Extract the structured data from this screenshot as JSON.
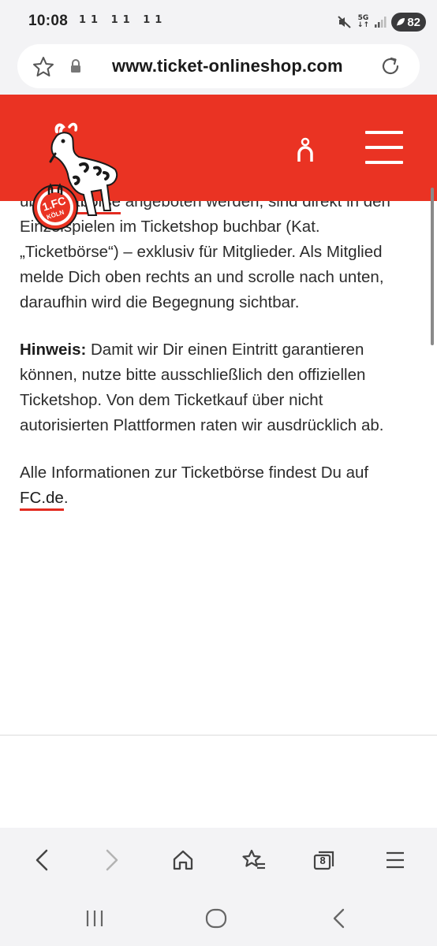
{
  "status": {
    "time": "10:08",
    "notifications": "11 11 11",
    "network": "5G",
    "battery": "82"
  },
  "browser": {
    "url": "www.ticket-onlineshop.com",
    "tab_count": "8"
  },
  "header": {
    "logo_text_top": "1.FC",
    "logo_text_bottom": "KÖLN"
  },
  "content": {
    "p1_cut_pre": "üb",
    "p1_cut_link": "Ticketbörse",
    "p1_cut_post": " angeboten werden, sind",
    "p1_rest": "direkt in den Einzelspielen im Ticketshop buchbar (Kat. „Ticketbörse“) – exklusiv für Mitglieder. Als Mitglied melde Dich oben rechts an und scrolle nach unten, daraufhin wird die Begegnung sichtbar.",
    "p2_label": "Hinweis:",
    "p2_text": " Damit wir Dir einen Eintritt garantieren können, nutze bitte ausschließlich den offiziellen Ticketshop. Von dem Ticketkauf über nicht autorisierten Plattformen raten wir ausdrücklich ab.",
    "p3_text": "Alle Informationen zur Ticketbörse findest Du auf ",
    "p3_link": "FC.de",
    "p3_end": "."
  },
  "colors": {
    "brand_red": "#ea3323",
    "link_underline": "#e32b20"
  },
  "icons": [
    "star-icon",
    "lock-icon",
    "reload-icon",
    "account-icon",
    "hamburger-menu-icon",
    "back-icon",
    "forward-icon",
    "home-icon",
    "bookmarks-icon",
    "tabs-icon",
    "more-menu-icon",
    "recent-apps-icon",
    "home-circle-icon",
    "nav-back-icon"
  ]
}
